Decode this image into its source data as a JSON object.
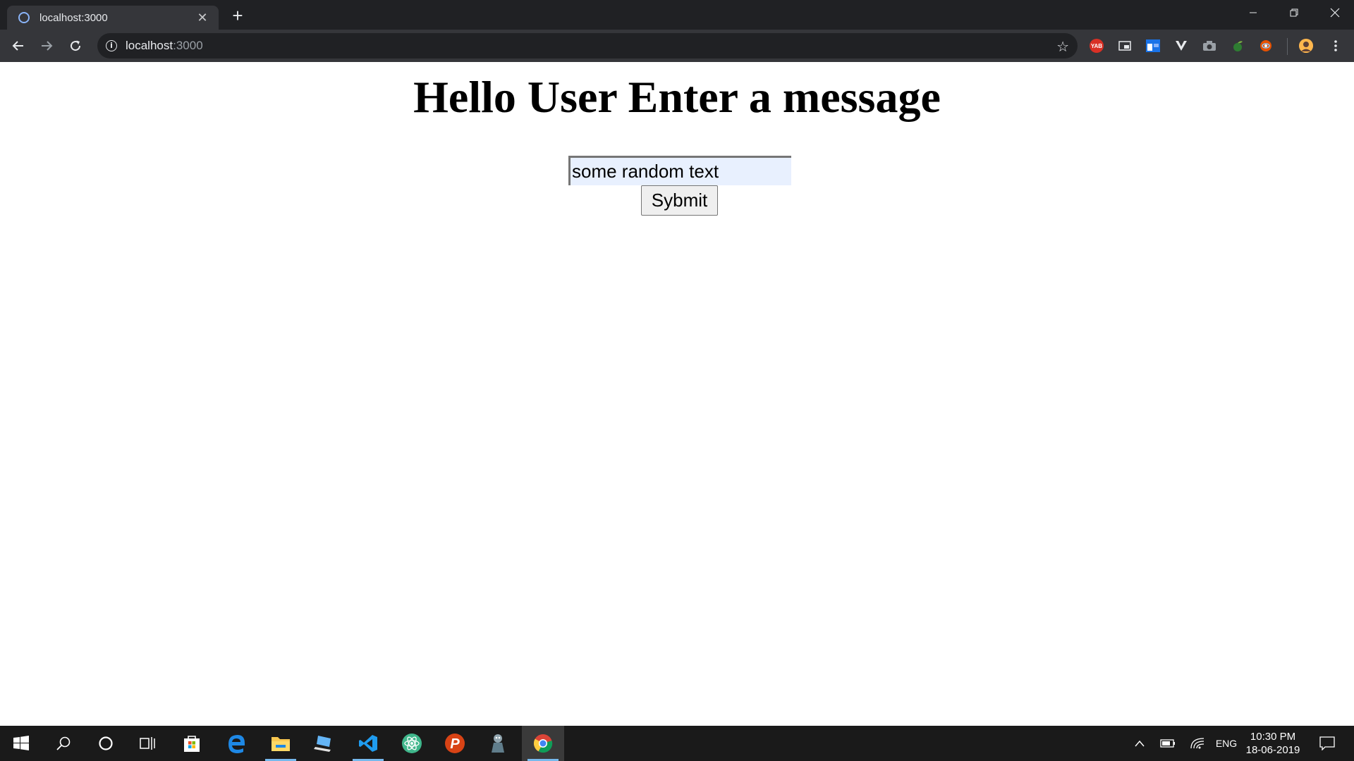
{
  "browser": {
    "tab": {
      "title": "localhost:3000",
      "close_glyph": "✕"
    },
    "new_tab_glyph": "+",
    "window_controls": {
      "minimize": "—",
      "maximize": "❐",
      "close": "✕"
    },
    "address_bar": {
      "host": "localhost",
      "port": ":3000"
    },
    "extensions": [
      {
        "name": "yab-extension-icon",
        "label": "YAB",
        "color": "#d93025"
      },
      {
        "name": "picture-in-picture-icon",
        "label": "",
        "color": "#5f6368"
      },
      {
        "name": "window-extension-icon",
        "label": "",
        "color": "#1a73e8"
      },
      {
        "name": "vimeo-extension-icon",
        "label": "",
        "color": "#35363a"
      },
      {
        "name": "camera-extension-icon",
        "label": "",
        "color": "#5f6368"
      },
      {
        "name": "leaf-extension-icon",
        "label": "",
        "color": "#2e7d32"
      },
      {
        "name": "globe-extension-icon",
        "label": "",
        "color": "#e65100"
      }
    ]
  },
  "page": {
    "heading": "Hello User Enter a message",
    "message_input": {
      "value": "some random text"
    },
    "submit_label": "Sybmit"
  },
  "taskbar": {
    "apps": [
      {
        "name": "start-button",
        "icon": "windows-icon"
      },
      {
        "name": "search-button",
        "icon": "search-icon"
      },
      {
        "name": "cortana-button",
        "icon": "cortana-icon"
      },
      {
        "name": "task-view-button",
        "icon": "task-view-icon"
      },
      {
        "name": "store-app",
        "icon": "store-icon"
      },
      {
        "name": "edge-app",
        "icon": "edge-icon"
      },
      {
        "name": "file-explorer-app",
        "icon": "folder-icon"
      },
      {
        "name": "device-app",
        "icon": "laptop-icon"
      },
      {
        "name": "vscode-app",
        "icon": "vscode-icon"
      },
      {
        "name": "atom-app",
        "icon": "atom-icon"
      },
      {
        "name": "p-app",
        "icon": "p-icon"
      },
      {
        "name": "character-app",
        "icon": "character-icon"
      },
      {
        "name": "chrome-app",
        "icon": "chrome-icon"
      }
    ],
    "tray": {
      "language": "ENG",
      "time": "10:30 PM",
      "date": "18-06-2019"
    },
    "colors": {
      "accent": "#76b9ed"
    }
  }
}
